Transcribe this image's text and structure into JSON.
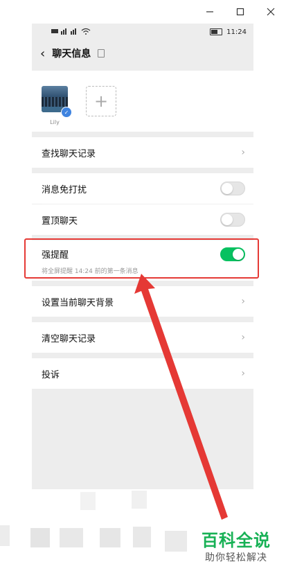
{
  "window": {
    "minimize_icon": "minimize-icon",
    "maximize_icon": "maximize-icon",
    "close_icon": "close-icon"
  },
  "statusbar": {
    "time": "11:24"
  },
  "nav": {
    "title": "聊天信息"
  },
  "members": [
    {
      "name": "Lily"
    }
  ],
  "cells": {
    "search_history": "查找聊天记录",
    "mute": "消息免打扰",
    "pin": "置顶聊天",
    "strong_remind": "强提醒",
    "strong_remind_sub": "将全屏提醒 14:24 前的第一条消息",
    "set_background": "设置当前聊天背景",
    "clear_history": "清空聊天记录",
    "complain": "投诉"
  },
  "toggles": {
    "mute": false,
    "pin": false,
    "strong_remind": true
  },
  "watermark": {
    "title": "百科全说",
    "subtitle": "助你轻松解决"
  },
  "colors": {
    "accent_green": "#07c160",
    "annotation_red": "#e53935",
    "watermark_green": "#17b155"
  }
}
